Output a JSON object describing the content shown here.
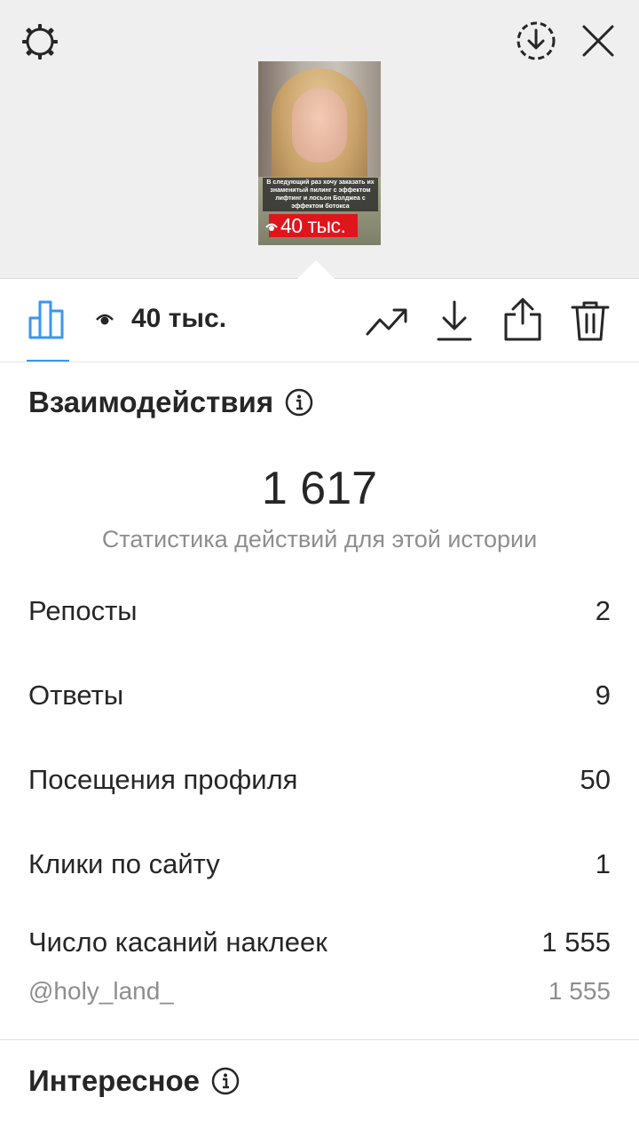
{
  "story_preview": {
    "caption": "В следующий раз хочу заказать их знаменитый пилинг с эффектом лифтинг и лосьон Болджеа с эффектом ботокса",
    "views_overlay": "40 тыс."
  },
  "toolbar": {
    "views_count": "40 тыс."
  },
  "interactions": {
    "title": "Взаимодействия",
    "total": "1 617",
    "caption": "Статистика действий для этой истории",
    "rows": [
      {
        "label": "Репосты",
        "value": "2"
      },
      {
        "label": "Ответы",
        "value": "9"
      },
      {
        "label": "Посещения профиля",
        "value": "50"
      },
      {
        "label": "Клики по сайту",
        "value": "1"
      },
      {
        "label": "Число касаний наклеек",
        "value": "1 555"
      }
    ],
    "sticker_detail": {
      "label": "@holy_land_",
      "value": "1 555"
    }
  },
  "discovery": {
    "title": "Интересное"
  },
  "colors": {
    "accent": "#3897f0",
    "text": "#262626",
    "muted": "#8e8e8e",
    "sticker_red": "#e0151b"
  },
  "icons": [
    "settings-icon",
    "save-circle-icon",
    "close-icon",
    "insights-bar-icon",
    "eye-icon",
    "promote-trend-icon",
    "download-icon",
    "share-icon",
    "trash-icon",
    "info-icon"
  ]
}
